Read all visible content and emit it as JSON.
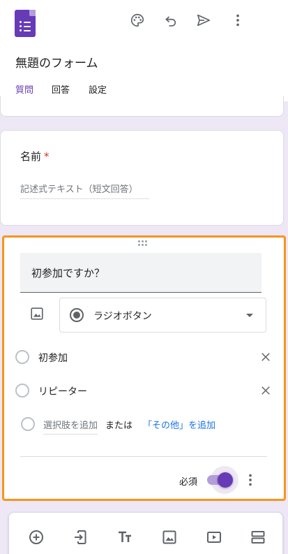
{
  "form": {
    "title": "無題のフォーム"
  },
  "tabs": [
    {
      "label": "質問",
      "active": true
    },
    {
      "label": "回答",
      "active": false
    },
    {
      "label": "設定",
      "active": false
    }
  ],
  "header_icons": [
    "palette-icon",
    "undo-icon",
    "send-icon",
    "more-vert-icon"
  ],
  "name_question": {
    "title": "名前",
    "required_mark": "*",
    "answer_placeholder": "記述式テキスト（短文回答）"
  },
  "active_question": {
    "text": "初参加ですか？",
    "type_label": "ラジオボタン",
    "options": [
      {
        "label": "初参加"
      },
      {
        "label": "リピーター"
      }
    ],
    "add_option": "選択肢を追加",
    "or": "または",
    "add_other": "「その他」を追加",
    "required_label": "必須",
    "required": true
  },
  "toolbar_icons": [
    "add-question-icon",
    "import-questions-icon",
    "add-title-icon",
    "add-image-icon",
    "add-video-icon",
    "add-section-icon"
  ],
  "colors": {
    "accent": "#673ab7",
    "background": "#ede7f6",
    "highlight_border": "#f7941d",
    "link": "#1a73e8",
    "required_star": "#d93025"
  }
}
